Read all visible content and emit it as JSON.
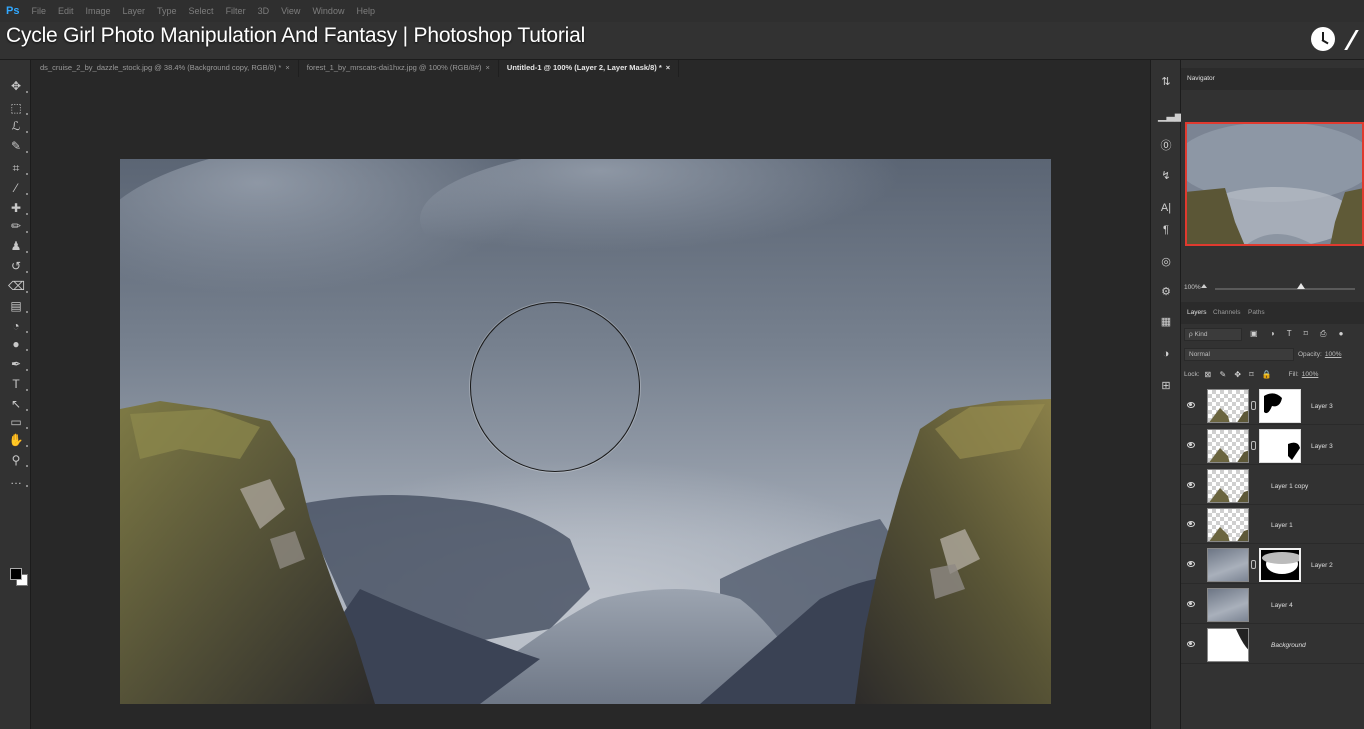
{
  "app": {
    "logo": "Ps"
  },
  "menu": [
    "File",
    "Edit",
    "Image",
    "Layer",
    "Type",
    "Select",
    "Filter",
    "3D",
    "View",
    "Window",
    "Help"
  ],
  "video_title": "Cycle Girl Photo Manipulation And Fantasy | Photoshop Tutorial",
  "tabs": [
    {
      "label": "ds_cruise_2_by_dazzle_stock.jpg @ 38.4% (Background copy, RGB/8) *",
      "close": "×"
    },
    {
      "label": "forest_1_by_mrscats-dai1hxz.jpg @ 100% (RGB/8#)",
      "close": "×"
    },
    {
      "label": "Untitled-1 @ 100% (Layer 2, Layer Mask/8) *",
      "close": "×"
    }
  ],
  "tools": [
    {
      "name": "move-tool-icon",
      "glyph": "✥"
    },
    {
      "name": "marquee-tool-icon",
      "glyph": "⬚"
    },
    {
      "name": "lasso-tool-icon",
      "glyph": "ℒ"
    },
    {
      "name": "quick-select-tool-icon",
      "glyph": "✎"
    },
    {
      "name": "crop-tool-icon",
      "glyph": "⌗"
    },
    {
      "name": "eyedropper-tool-icon",
      "glyph": "⁄"
    },
    {
      "name": "healing-tool-icon",
      "glyph": "✚"
    },
    {
      "name": "brush-tool-icon",
      "glyph": "✏"
    },
    {
      "name": "stamp-tool-icon",
      "glyph": "♟"
    },
    {
      "name": "history-brush-tool-icon",
      "glyph": "↺"
    },
    {
      "name": "eraser-tool-icon",
      "glyph": "⌫"
    },
    {
      "name": "gradient-tool-icon",
      "glyph": "▤"
    },
    {
      "name": "blur-tool-icon",
      "glyph": "◔"
    },
    {
      "name": "dodge-tool-icon",
      "glyph": "●"
    },
    {
      "name": "pen-tool-icon",
      "glyph": "✒"
    },
    {
      "name": "type-tool-icon",
      "glyph": "T"
    },
    {
      "name": "path-select-tool-icon",
      "glyph": "↖"
    },
    {
      "name": "shape-tool-icon",
      "glyph": "▭"
    },
    {
      "name": "hand-tool-icon",
      "glyph": "✋"
    },
    {
      "name": "zoom-tool-icon",
      "glyph": "⚲"
    },
    {
      "name": "more-tools-icon",
      "glyph": "…"
    }
  ],
  "side_icons": [
    {
      "name": "history-icon",
      "glyph": "⇅"
    },
    {
      "name": "histogram-icon",
      "glyph": "▁▃▅"
    },
    {
      "name": "info-icon",
      "glyph": "⓪"
    },
    {
      "name": "brush-settings-icon",
      "glyph": "↯"
    },
    {
      "name": "character-icon",
      "glyph": "A|"
    },
    {
      "name": "paragraph-icon",
      "glyph": "¶"
    },
    {
      "name": "adjustments-icon",
      "glyph": "◎"
    },
    {
      "name": "properties-icon",
      "glyph": "⚙"
    },
    {
      "name": "swatches-icon",
      "glyph": "▦"
    },
    {
      "name": "color-icon",
      "glyph": "◑"
    },
    {
      "name": "libraries-icon",
      "glyph": "⊞"
    }
  ],
  "navigator": {
    "tab": "Navigator",
    "zoom": "100%"
  },
  "layers_panel": {
    "tabs": [
      "Layers",
      "Channels",
      "Paths"
    ],
    "kind_label": "ρ Kind",
    "kind_icons": "▣ ◑ T ⌑ ⎙ ●",
    "blend_mode": "Normal",
    "opacity_label": "Opacity:",
    "opacity_value": "100%",
    "lock_label": "Lock:",
    "lock_icons": "⊠ ✎ ✥ ⌑ 🔒",
    "fill_label": "Fill:",
    "fill_value": "100%",
    "layers": [
      {
        "name": "Layer 3",
        "has_mask": true,
        "thumb": "transparent",
        "italic": false
      },
      {
        "name": "Layer 3",
        "has_mask": true,
        "thumb": "transparent",
        "italic": false
      },
      {
        "name": "Layer 1 copy",
        "has_mask": false,
        "thumb": "transparent",
        "italic": false
      },
      {
        "name": "Layer 1",
        "has_mask": false,
        "thumb": "transparent",
        "italic": false
      },
      {
        "name": "Layer 2",
        "has_mask": true,
        "thumb": "sky",
        "italic": false,
        "selected": true
      },
      {
        "name": "Layer 4",
        "has_mask": false,
        "thumb": "sky",
        "italic": false
      },
      {
        "name": "Background",
        "has_mask": false,
        "thumb": "white",
        "italic": true
      }
    ]
  },
  "colors": {
    "selection_red": "#e03a2f",
    "accent_blue": "#31a8ff"
  }
}
